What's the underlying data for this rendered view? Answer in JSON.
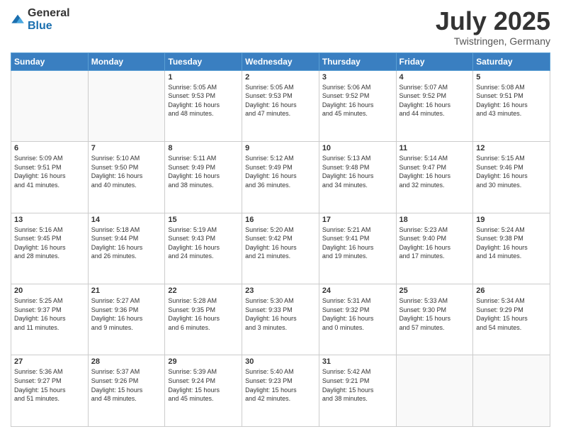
{
  "logo": {
    "general": "General",
    "blue": "Blue"
  },
  "header": {
    "month": "July 2025",
    "location": "Twistringen, Germany"
  },
  "weekdays": [
    "Sunday",
    "Monday",
    "Tuesday",
    "Wednesday",
    "Thursday",
    "Friday",
    "Saturday"
  ],
  "weeks": [
    [
      {
        "day": "",
        "info": ""
      },
      {
        "day": "",
        "info": ""
      },
      {
        "day": "1",
        "info": "Sunrise: 5:05 AM\nSunset: 9:53 PM\nDaylight: 16 hours\nand 48 minutes."
      },
      {
        "day": "2",
        "info": "Sunrise: 5:05 AM\nSunset: 9:53 PM\nDaylight: 16 hours\nand 47 minutes."
      },
      {
        "day": "3",
        "info": "Sunrise: 5:06 AM\nSunset: 9:52 PM\nDaylight: 16 hours\nand 45 minutes."
      },
      {
        "day": "4",
        "info": "Sunrise: 5:07 AM\nSunset: 9:52 PM\nDaylight: 16 hours\nand 44 minutes."
      },
      {
        "day": "5",
        "info": "Sunrise: 5:08 AM\nSunset: 9:51 PM\nDaylight: 16 hours\nand 43 minutes."
      }
    ],
    [
      {
        "day": "6",
        "info": "Sunrise: 5:09 AM\nSunset: 9:51 PM\nDaylight: 16 hours\nand 41 minutes."
      },
      {
        "day": "7",
        "info": "Sunrise: 5:10 AM\nSunset: 9:50 PM\nDaylight: 16 hours\nand 40 minutes."
      },
      {
        "day": "8",
        "info": "Sunrise: 5:11 AM\nSunset: 9:49 PM\nDaylight: 16 hours\nand 38 minutes."
      },
      {
        "day": "9",
        "info": "Sunrise: 5:12 AM\nSunset: 9:49 PM\nDaylight: 16 hours\nand 36 minutes."
      },
      {
        "day": "10",
        "info": "Sunrise: 5:13 AM\nSunset: 9:48 PM\nDaylight: 16 hours\nand 34 minutes."
      },
      {
        "day": "11",
        "info": "Sunrise: 5:14 AM\nSunset: 9:47 PM\nDaylight: 16 hours\nand 32 minutes."
      },
      {
        "day": "12",
        "info": "Sunrise: 5:15 AM\nSunset: 9:46 PM\nDaylight: 16 hours\nand 30 minutes."
      }
    ],
    [
      {
        "day": "13",
        "info": "Sunrise: 5:16 AM\nSunset: 9:45 PM\nDaylight: 16 hours\nand 28 minutes."
      },
      {
        "day": "14",
        "info": "Sunrise: 5:18 AM\nSunset: 9:44 PM\nDaylight: 16 hours\nand 26 minutes."
      },
      {
        "day": "15",
        "info": "Sunrise: 5:19 AM\nSunset: 9:43 PM\nDaylight: 16 hours\nand 24 minutes."
      },
      {
        "day": "16",
        "info": "Sunrise: 5:20 AM\nSunset: 9:42 PM\nDaylight: 16 hours\nand 21 minutes."
      },
      {
        "day": "17",
        "info": "Sunrise: 5:21 AM\nSunset: 9:41 PM\nDaylight: 16 hours\nand 19 minutes."
      },
      {
        "day": "18",
        "info": "Sunrise: 5:23 AM\nSunset: 9:40 PM\nDaylight: 16 hours\nand 17 minutes."
      },
      {
        "day": "19",
        "info": "Sunrise: 5:24 AM\nSunset: 9:38 PM\nDaylight: 16 hours\nand 14 minutes."
      }
    ],
    [
      {
        "day": "20",
        "info": "Sunrise: 5:25 AM\nSunset: 9:37 PM\nDaylight: 16 hours\nand 11 minutes."
      },
      {
        "day": "21",
        "info": "Sunrise: 5:27 AM\nSunset: 9:36 PM\nDaylight: 16 hours\nand 9 minutes."
      },
      {
        "day": "22",
        "info": "Sunrise: 5:28 AM\nSunset: 9:35 PM\nDaylight: 16 hours\nand 6 minutes."
      },
      {
        "day": "23",
        "info": "Sunrise: 5:30 AM\nSunset: 9:33 PM\nDaylight: 16 hours\nand 3 minutes."
      },
      {
        "day": "24",
        "info": "Sunrise: 5:31 AM\nSunset: 9:32 PM\nDaylight: 16 hours\nand 0 minutes."
      },
      {
        "day": "25",
        "info": "Sunrise: 5:33 AM\nSunset: 9:30 PM\nDaylight: 15 hours\nand 57 minutes."
      },
      {
        "day": "26",
        "info": "Sunrise: 5:34 AM\nSunset: 9:29 PM\nDaylight: 15 hours\nand 54 minutes."
      }
    ],
    [
      {
        "day": "27",
        "info": "Sunrise: 5:36 AM\nSunset: 9:27 PM\nDaylight: 15 hours\nand 51 minutes."
      },
      {
        "day": "28",
        "info": "Sunrise: 5:37 AM\nSunset: 9:26 PM\nDaylight: 15 hours\nand 48 minutes."
      },
      {
        "day": "29",
        "info": "Sunrise: 5:39 AM\nSunset: 9:24 PM\nDaylight: 15 hours\nand 45 minutes."
      },
      {
        "day": "30",
        "info": "Sunrise: 5:40 AM\nSunset: 9:23 PM\nDaylight: 15 hours\nand 42 minutes."
      },
      {
        "day": "31",
        "info": "Sunrise: 5:42 AM\nSunset: 9:21 PM\nDaylight: 15 hours\nand 38 minutes."
      },
      {
        "day": "",
        "info": ""
      },
      {
        "day": "",
        "info": ""
      }
    ]
  ]
}
